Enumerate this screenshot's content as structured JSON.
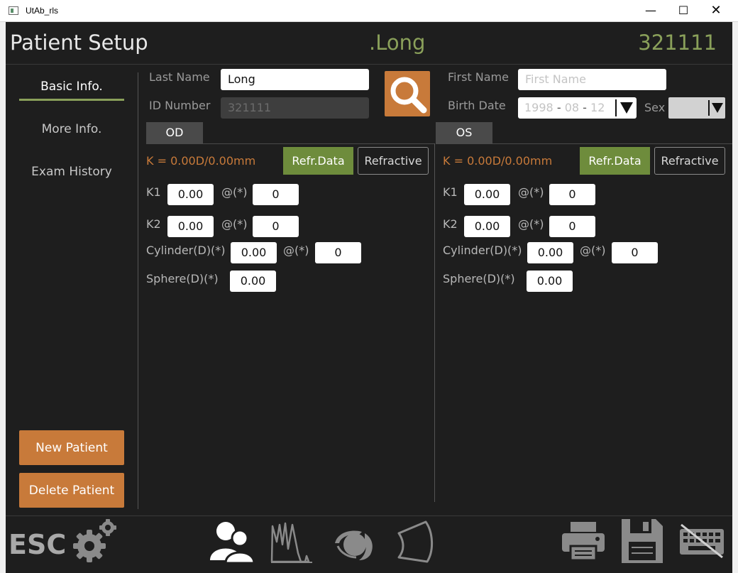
{
  "window": {
    "title": "UtAb_rls",
    "min_label": "—",
    "max_label": "☐",
    "close_label": "✕"
  },
  "header": {
    "title": "Patient Setup",
    "patient_name": ".Long",
    "patient_id": "321111"
  },
  "sidebar": {
    "items": [
      {
        "label": "Basic Info.",
        "active": true
      },
      {
        "label": "More Info.",
        "active": false
      },
      {
        "label": "Exam History",
        "active": false
      }
    ],
    "new_patient": "New Patient",
    "delete_patient": "Delete Patient"
  },
  "form": {
    "last_name_label": "Last Name",
    "last_name_value": "Long",
    "id_label": "ID Number",
    "id_value": "321111",
    "first_name_label": "First Name",
    "first_name_placeholder": "First Name",
    "birth_label": "Birth Date",
    "birth_year": "1998",
    "birth_month": "08",
    "birth_day": "12",
    "date_sep": "-",
    "sex_label": "Sex"
  },
  "eyes": {
    "od": {
      "tab": "OD",
      "k_summary": "K = 0.00D/0.00mm",
      "refr_data": "Refr.Data",
      "refractive": "Refractive",
      "k1_label": "K1",
      "k1": "0.00",
      "k1_axis_label": "@(*)",
      "k1_axis": "0",
      "k2_label": "K2",
      "k2": "0.00",
      "k2_axis_label": "@(*)",
      "k2_axis": "0",
      "cyl_label": "Cylinder(D)(*)",
      "cyl": "0.00",
      "cyl_axis_label": "@(*)",
      "cyl_axis": "0",
      "sph_label": "Sphere(D)(*)",
      "sph": "0.00"
    },
    "os": {
      "tab": "OS",
      "k_summary": "K = 0.00D/0.00mm",
      "refr_data": "Refr.Data",
      "refractive": "Refractive",
      "k1_label": "K1",
      "k1": "0.00",
      "k1_axis_label": "@(*)",
      "k1_axis": "0",
      "k2_label": "K2",
      "k2": "0.00",
      "k2_axis_label": "@(*)",
      "k2_axis": "0",
      "cyl_label": "Cylinder(D)(*)",
      "cyl": "0.00",
      "cyl_axis_label": "@(*)",
      "cyl_axis": "0",
      "sph_label": "Sphere(D)(*)",
      "sph": "0.00"
    }
  },
  "toolbar": {
    "esc_label": "ESC",
    "icons": [
      "gear-icon",
      "patients-icon",
      "waveform-icon",
      "eye-icon",
      "lens-icon",
      "printer-icon",
      "save-icon",
      "keyboard-off-icon"
    ]
  },
  "colors": {
    "accent_orange": "#c87a3a",
    "accent_green": "#8aa05a",
    "button_green": "#6e8c3c",
    "background": "#1e1e1e"
  }
}
